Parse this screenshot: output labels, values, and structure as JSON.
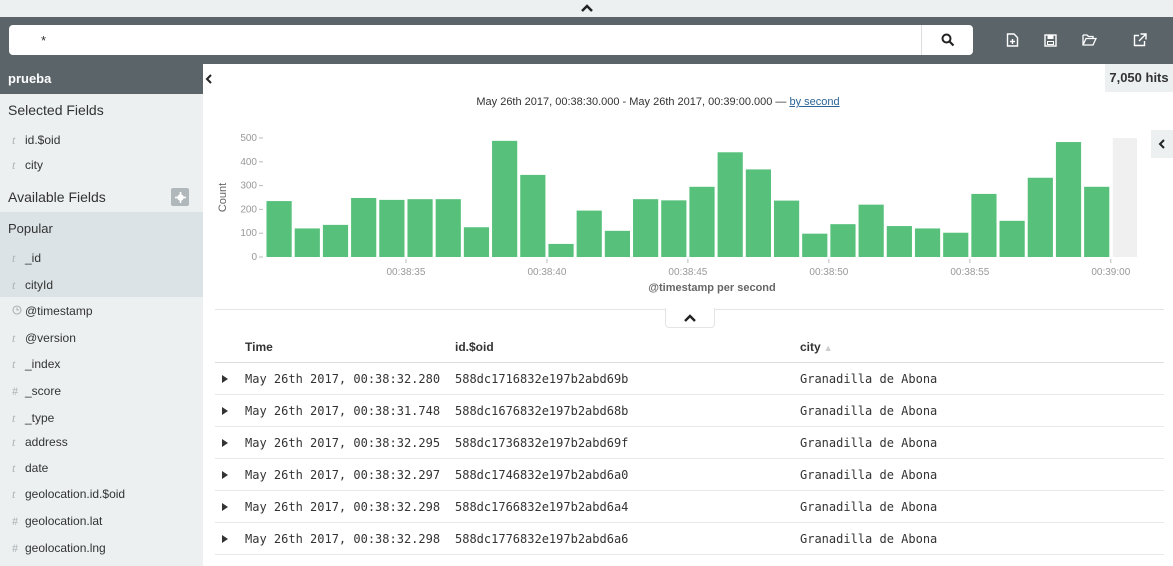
{
  "query": {
    "value": "*"
  },
  "toolbar": {
    "icons": [
      "new-document-icon",
      "save-icon",
      "open-folder-icon",
      "share-icon"
    ]
  },
  "index": {
    "name": "prueba"
  },
  "sidebar": {
    "selected_title": "Selected Fields",
    "selected_fields": [
      {
        "type": "t",
        "name": "id.$oid"
      },
      {
        "type": "t",
        "name": "city"
      }
    ],
    "available_title": "Available Fields",
    "popular_title": "Popular",
    "popular_fields": [
      {
        "type": "t",
        "name": "_id"
      },
      {
        "type": "t",
        "name": "cityId"
      }
    ],
    "fields": [
      {
        "type": "clock",
        "name": "@timestamp"
      },
      {
        "type": "t",
        "name": "@version"
      },
      {
        "type": "t",
        "name": "_index"
      },
      {
        "type": "#",
        "name": "_score"
      },
      {
        "type": "t",
        "name": "_type"
      },
      {
        "type": "t",
        "name": "address"
      },
      {
        "type": "t",
        "name": "date"
      },
      {
        "type": "t",
        "name": "geolocation.id.$oid"
      },
      {
        "type": "#",
        "name": "geolocation.lat"
      },
      {
        "type": "#",
        "name": "geolocation.lng"
      }
    ]
  },
  "hits": {
    "label": "7,050 hits"
  },
  "range": {
    "text": "May 26th 2017, 00:38:30.000 - May 26th 2017, 00:39:00.000 — ",
    "interval_link": "by second"
  },
  "colors": {
    "bar": "#57c17b",
    "header": "#5a6469",
    "sidebar": "#ecf0f1",
    "link": "#2a6496"
  },
  "chart_data": {
    "type": "bar",
    "ylabel": "Count",
    "xlabel": "@timestamp per second",
    "ylim": [
      0,
      500
    ],
    "yticks": [
      0,
      100,
      200,
      300,
      400,
      500
    ],
    "xticks": [
      "00:38:35",
      "00:38:40",
      "00:38:45",
      "00:38:50",
      "00:38:55",
      "00:39:00"
    ],
    "categories": [
      "00:38:30",
      "00:38:31",
      "00:38:32",
      "00:38:33",
      "00:38:34",
      "00:38:35",
      "00:38:36",
      "00:38:37",
      "00:38:38",
      "00:38:39",
      "00:38:40",
      "00:38:41",
      "00:38:42",
      "00:38:43",
      "00:38:44",
      "00:38:45",
      "00:38:46",
      "00:38:47",
      "00:38:48",
      "00:38:49",
      "00:38:50",
      "00:38:51",
      "00:38:52",
      "00:38:53",
      "00:38:54",
      "00:38:55",
      "00:38:56",
      "00:38:57",
      "00:38:58",
      "00:38:59"
    ],
    "values": [
      235,
      120,
      135,
      248,
      240,
      243,
      243,
      125,
      488,
      345,
      55,
      195,
      110,
      243,
      238,
      295,
      440,
      368,
      237,
      98,
      138,
      220,
      130,
      120,
      102,
      265,
      152,
      333,
      483,
      295
    ],
    "highlight_after": "00:39:00",
    "grid": false
  },
  "table": {
    "columns": [
      "Time",
      "id.$oid",
      "city"
    ],
    "rows": [
      [
        "May 26th 2017, 00:38:32.280",
        "588dc1716832e197b2abd69b",
        "Granadilla de Abona"
      ],
      [
        "May 26th 2017, 00:38:31.748",
        "588dc1676832e197b2abd68b",
        "Granadilla de Abona"
      ],
      [
        "May 26th 2017, 00:38:32.295",
        "588dc1736832e197b2abd69f",
        "Granadilla de Abona"
      ],
      [
        "May 26th 2017, 00:38:32.297",
        "588dc1746832e197b2abd6a0",
        "Granadilla de Abona"
      ],
      [
        "May 26th 2017, 00:38:32.298",
        "588dc1766832e197b2abd6a4",
        "Granadilla de Abona"
      ],
      [
        "May 26th 2017, 00:38:32.298",
        "588dc1776832e197b2abd6a6",
        "Granadilla de Abona"
      ]
    ]
  }
}
